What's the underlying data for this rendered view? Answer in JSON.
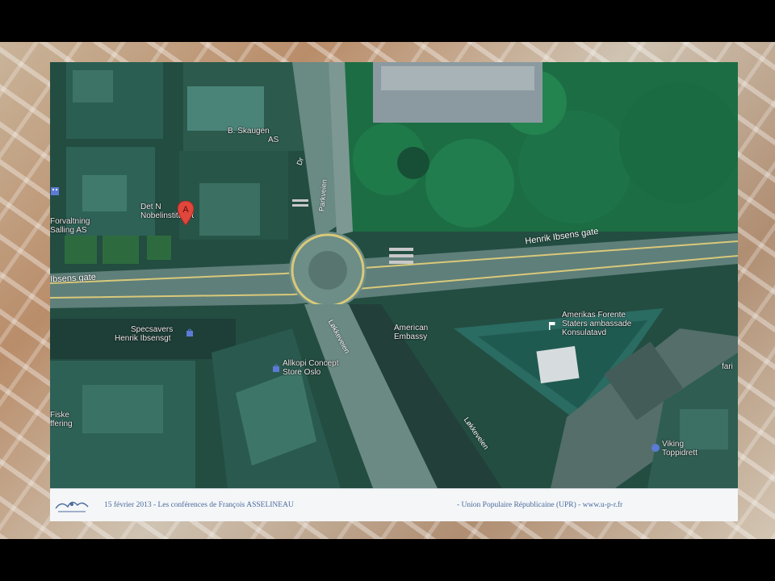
{
  "map": {
    "marker": {
      "letter": "A",
      "color": "#e0463c"
    },
    "streets": [
      {
        "id": "henrik-ibsens-gate-east",
        "label": "Henrik Ibsens gate"
      },
      {
        "id": "henrik-ibsens-gate-west",
        "label": "Ibsens gate"
      },
      {
        "id": "lokkeveien-north",
        "label": "Løkkeveien"
      },
      {
        "id": "lokkeveien-south",
        "label": "Løkkeveien"
      },
      {
        "id": "parkveien",
        "label": "Parkveien"
      },
      {
        "id": "drammensveien-stub",
        "label": "Dr"
      }
    ],
    "places": [
      {
        "id": "skaugen",
        "line1": "B. Skaugen",
        "line2": "AS"
      },
      {
        "id": "nobel",
        "line1": "Det N",
        "line2": "Nobelinstituttet"
      },
      {
        "id": "forvaltning",
        "line1": "Forvaltning",
        "line2": "Salling AS"
      },
      {
        "id": "specsavers",
        "line1": "Specsavers",
        "line2": "Henrik Ibsensgt"
      },
      {
        "id": "allkopi",
        "line1": "Allkopi Concept",
        "line2": "Store Oslo"
      },
      {
        "id": "american-embassy",
        "line1": "American",
        "line2": "Embassy"
      },
      {
        "id": "amerikas-forente",
        "line1": "Amerikas Forente",
        "line2": "Staters ambassade",
        "line3": "Konsulatavd"
      },
      {
        "id": "viking",
        "line1": "Viking",
        "line2": "Toppidrett"
      },
      {
        "id": "fiskeri",
        "line1": "Fiske",
        "line2": "ffering"
      },
      {
        "id": "edge-right",
        "line1": "fari",
        "line2": ""
      }
    ],
    "accent_colors": {
      "road_yellow": "#d9c97a",
      "vegetation": "#1f7a4a",
      "roof": "#2a6b62"
    }
  },
  "footer": {
    "left_text": "15 février 2013 - Les conférences de François ASSELINEAU",
    "right_text": "- Union Populaire Républicaine (UPR) - www.u-p-r.fr",
    "text_color": "#4a6a9a"
  }
}
